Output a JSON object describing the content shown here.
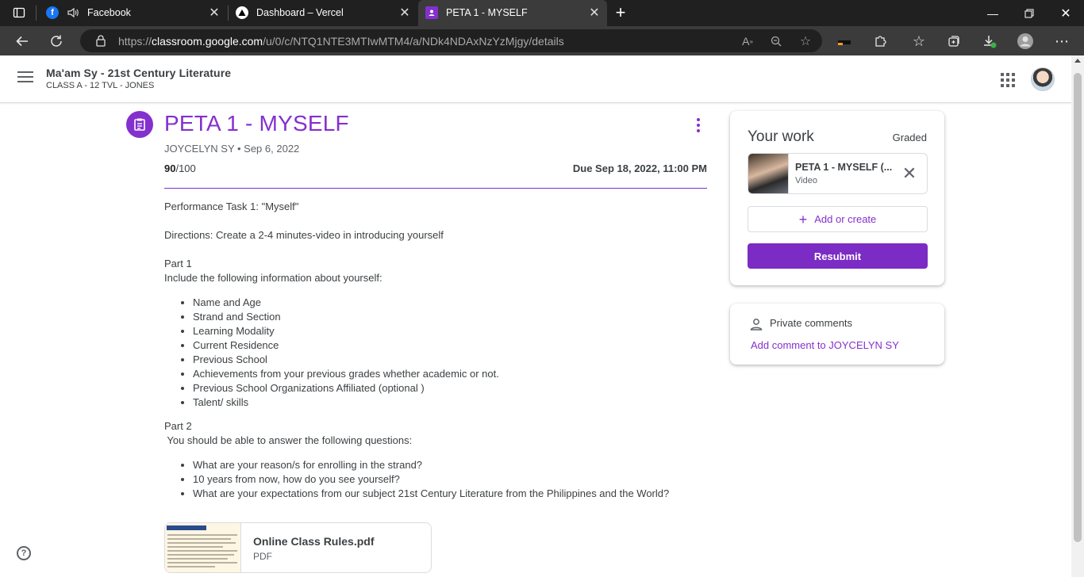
{
  "browser": {
    "tabs": [
      {
        "title": "Facebook",
        "icon": "facebook-icon",
        "muted": true
      },
      {
        "title": "Dashboard – Vercel",
        "icon": "vercel-icon"
      },
      {
        "title": "PETA 1 - MYSELF",
        "icon": "classroom-icon",
        "active": true
      }
    ],
    "url_prefix": "https://",
    "url_host": "classroom.google.com",
    "url_path": "/u/0/c/NTQ1NTE3MTIwMTM4/a/NDk4NDAxNzYzMjgy/details"
  },
  "appbar": {
    "course_title": "Ma'am Sy - 21st Century Literature",
    "course_subtitle": "CLASS A - 12 TVL - JONES"
  },
  "assignment": {
    "title": "PETA 1 - MYSELF",
    "meta": "JOYCELYN SY • Sep 6, 2022",
    "score_value": "90",
    "score_total": "/100",
    "due": "Due Sep 18, 2022, 11:00 PM",
    "line1": "Performance Task 1: \"Myself\"",
    "line2": "Directions: Create a 2-4 minutes-video in introducing yourself",
    "part1_title": "Part 1",
    "part1_intro": "Include the following information about yourself:",
    "part1_items": [
      "Name and Age",
      "Strand and Section",
      "Learning Modality",
      "Current Residence",
      "Previous School",
      "Achievements from your previous grades whether academic or not.",
      "Previous School Organizations Affiliated (optional )",
      "Talent/ skills"
    ],
    "part2_title": "Part 2",
    "part2_intro": " You should be able to answer the following questions:",
    "part2_items": [
      "What are your reason/s for enrolling in the strand?",
      "10 years from now, how do you see yourself?",
      "What are your expectations from our subject 21st Century Literature from the Philippines and the World?"
    ],
    "attachment": {
      "name": "Online Class Rules.pdf",
      "type": "PDF"
    }
  },
  "your_work": {
    "title": "Your work",
    "status": "Graded",
    "item_name": "PETA 1 - MYSELF (...",
    "item_type": "Video",
    "add_label": "Add or create",
    "resubmit_label": "Resubmit"
  },
  "private_comments": {
    "title": "Private comments",
    "add_label": "Add comment to JOYCELYN SY"
  }
}
